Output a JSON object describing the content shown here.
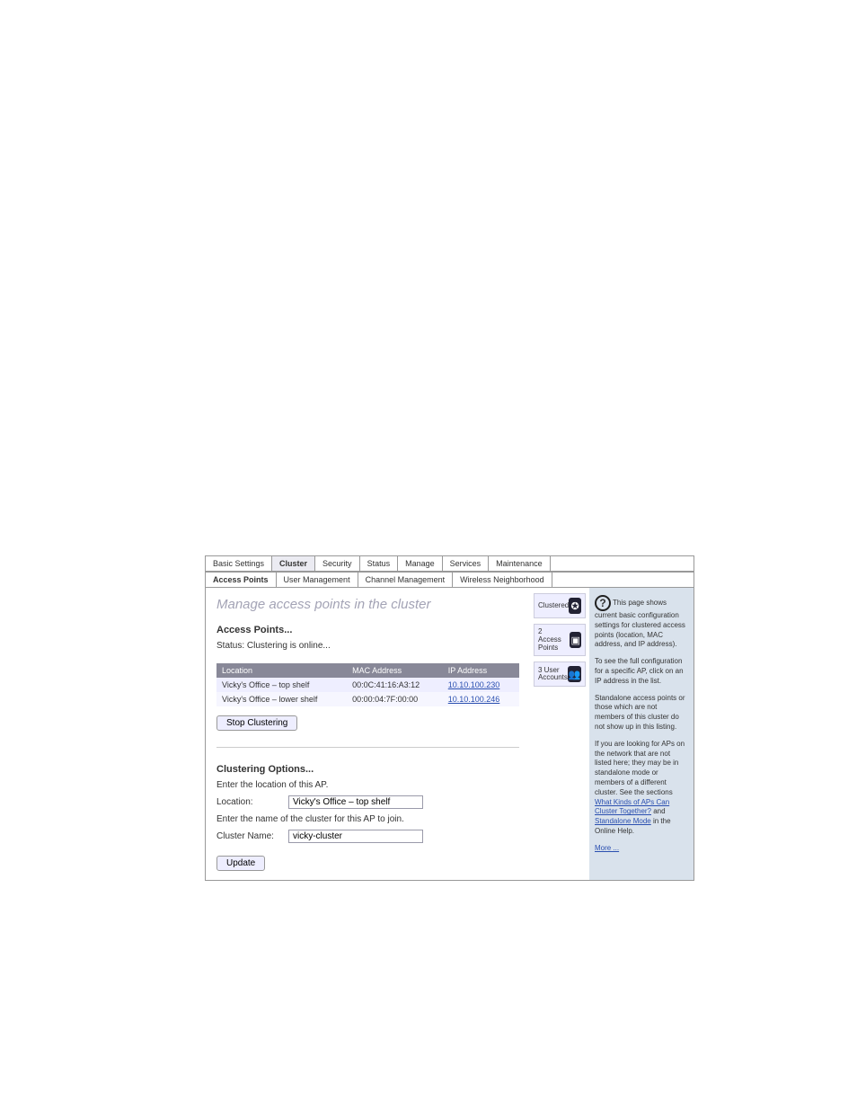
{
  "tabs": {
    "primary": [
      "Basic Settings",
      "Cluster",
      "Security",
      "Status",
      "Manage",
      "Services",
      "Maintenance"
    ],
    "primary_active": 1,
    "secondary": [
      "Access Points",
      "User Management",
      "Channel Management",
      "Wireless Neighborhood"
    ],
    "secondary_active": 0
  },
  "page": {
    "title": "Manage access points in the cluster",
    "section1": "Access Points...",
    "status": "Status: Clustering is online...",
    "table": {
      "headers": [
        "Location",
        "MAC Address",
        "IP Address"
      ],
      "rows": [
        {
          "loc": "Vicky's Office – top shelf",
          "mac": "00:0C:41:16:A3:12",
          "ip": "10.10.100.230"
        },
        {
          "loc": "Vicky's Office – lower shelf",
          "mac": "00:00:04:7F:00:00",
          "ip": "10.10.100.246"
        }
      ]
    },
    "stop_btn": "Stop Clustering",
    "section2": "Clustering Options...",
    "hint1": "Enter the location of this AP.",
    "loc_label": "Location:",
    "loc_value": "Vicky's Office – top shelf",
    "hint2": "Enter the name of the cluster for this AP to join.",
    "cluster_label": "Cluster Name:",
    "cluster_value": "vicky-cluster",
    "update_btn": "Update"
  },
  "side": {
    "clustered": "Clustered",
    "ap_count": "2",
    "ap_label": "Access Points",
    "user_count": "3 User",
    "user_label": "Accounts"
  },
  "help": {
    "p1": "This page shows current basic configuration settings for clustered access points (location, MAC address, and IP address).",
    "p2": "To see the full configuration for a specific AP, click on an IP address in the list.",
    "p3": "Standalone access points or those which are not members of this cluster do not show up in this listing.",
    "p4a": "If you are looking for APs on the network that are not listed here; they may be in standalone mode or members of a different cluster. See the sections ",
    "link1": "What Kinds of APs Can Cluster Together?",
    "mid": " and ",
    "link2": "Standalone Mode",
    "p4b": " in the Online Help.",
    "more": "More ..."
  }
}
